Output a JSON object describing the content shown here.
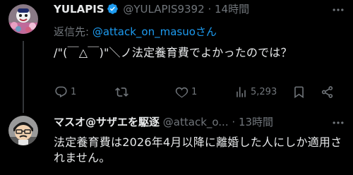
{
  "tweet1": {
    "display_name": "YULAPIS",
    "handle": "@YULAPIS9392",
    "separator": "·",
    "time": "14時間",
    "reply_prefix": "返信先: ",
    "reply_handle": "@attack_on_masuo",
    "reply_suffix": "さん",
    "text": "/\"(￣△￣)\"＼ノ法定養育費でよかったのでは？",
    "counts": {
      "replies": "1",
      "retweets": "",
      "likes": "1",
      "views": "5,293"
    }
  },
  "tweet2": {
    "display_name": "マスオ@サザエを駆逐",
    "handle": "@attack_o...",
    "separator": "·",
    "time": "13時間",
    "text": "法定養育費は2026年4月以降に離婚した人にしか適用されません。"
  },
  "colors": {
    "background": "#000000",
    "text": "#e7e9ea",
    "muted": "#71767b",
    "link": "#1d9bf0",
    "verified": "#1d9bf0",
    "thread_line": "#333639"
  },
  "icons": {
    "verified": "verified-badge-icon",
    "more": "more-dots-icon",
    "reply": "reply-bubble-icon",
    "retweet": "retweet-icon",
    "like": "heart-icon",
    "views": "views-bar-chart-icon",
    "bookmark": "bookmark-icon",
    "share": "share-icon"
  }
}
